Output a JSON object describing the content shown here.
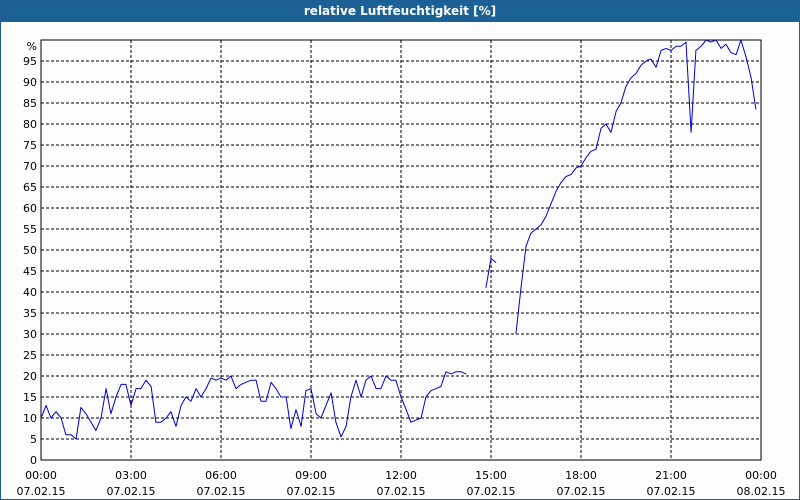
{
  "window": {
    "title": "relative Luftfeuchtigkeit [%]"
  },
  "chart_data": {
    "type": "line",
    "title": "relative Luftfeuchtigkeit [%]",
    "ylabel": "%",
    "ylim": [
      0,
      100
    ],
    "y_ticks": [
      "0",
      "5",
      "10",
      "15",
      "20",
      "25",
      "30",
      "35",
      "40",
      "45",
      "50",
      "55",
      "60",
      "65",
      "70",
      "75",
      "80",
      "85",
      "90",
      "95"
    ],
    "x_ticks": [
      {
        "time": "00:00",
        "date": "07.02.15"
      },
      {
        "time": "03:00",
        "date": "07.02.15"
      },
      {
        "time": "06:00",
        "date": "07.02.15"
      },
      {
        "time": "09:00",
        "date": "07.02.15"
      },
      {
        "time": "12:00",
        "date": "07.02.15"
      },
      {
        "time": "15:00",
        "date": "07.02.15"
      },
      {
        "time": "18:00",
        "date": "07.02.15"
      },
      {
        "time": "21:00",
        "date": "07.02.15"
      },
      {
        "time": "00:00",
        "date": "08.02.15"
      }
    ],
    "xlim_hours": [
      0,
      24
    ],
    "grid": true,
    "line_color": "#0000cc",
    "segments": [
      [
        [
          0.0,
          10
        ],
        [
          0.17,
          13
        ],
        [
          0.33,
          10
        ],
        [
          0.5,
          11.5
        ],
        [
          0.67,
          10
        ],
        [
          0.83,
          6
        ],
        [
          1.0,
          6
        ],
        [
          1.17,
          5
        ],
        [
          1.33,
          12.5
        ],
        [
          1.5,
          11
        ],
        [
          1.67,
          9
        ],
        [
          1.83,
          7
        ],
        [
          2.0,
          10
        ],
        [
          2.17,
          17
        ],
        [
          2.33,
          11
        ],
        [
          2.5,
          15
        ],
        [
          2.67,
          18
        ],
        [
          2.83,
          18
        ],
        [
          3.0,
          13
        ],
        [
          3.17,
          17
        ],
        [
          3.33,
          17
        ],
        [
          3.5,
          19
        ],
        [
          3.67,
          17.5
        ],
        [
          3.83,
          9
        ],
        [
          4.0,
          9
        ],
        [
          4.17,
          10
        ],
        [
          4.33,
          11.5
        ],
        [
          4.5,
          8
        ],
        [
          4.67,
          13
        ],
        [
          4.83,
          15
        ],
        [
          5.0,
          14
        ],
        [
          5.17,
          17
        ],
        [
          5.33,
          15
        ],
        [
          5.5,
          17
        ],
        [
          5.67,
          19.5
        ],
        [
          5.83,
          19
        ],
        [
          6.0,
          19.5
        ],
        [
          6.17,
          19
        ],
        [
          6.33,
          20
        ],
        [
          6.5,
          17
        ],
        [
          6.67,
          18
        ],
        [
          6.83,
          18.5
        ],
        [
          7.0,
          19
        ],
        [
          7.17,
          19
        ],
        [
          7.33,
          14
        ],
        [
          7.5,
          14
        ],
        [
          7.67,
          18.5
        ],
        [
          7.83,
          17
        ],
        [
          8.0,
          15
        ],
        [
          8.17,
          15
        ],
        [
          8.33,
          7.5
        ],
        [
          8.5,
          12
        ],
        [
          8.67,
          8
        ],
        [
          8.83,
          16.5
        ],
        [
          9.0,
          17
        ],
        [
          9.17,
          11
        ],
        [
          9.33,
          10
        ],
        [
          9.5,
          13
        ],
        [
          9.67,
          16
        ],
        [
          9.83,
          9
        ],
        [
          10.0,
          5.5
        ],
        [
          10.17,
          8
        ],
        [
          10.33,
          15
        ],
        [
          10.5,
          19
        ],
        [
          10.67,
          15
        ],
        [
          10.83,
          19
        ],
        [
          11.0,
          20
        ],
        [
          11.17,
          17
        ],
        [
          11.33,
          17
        ],
        [
          11.5,
          20
        ],
        [
          11.67,
          19
        ],
        [
          11.83,
          19
        ],
        [
          12.0,
          15
        ],
        [
          12.17,
          12
        ],
        [
          12.33,
          9
        ],
        [
          12.5,
          9.5
        ],
        [
          12.67,
          10
        ],
        [
          12.83,
          15
        ],
        [
          13.0,
          16.5
        ],
        [
          13.17,
          17
        ],
        [
          13.33,
          17.5
        ],
        [
          13.5,
          21
        ],
        [
          13.67,
          20.5
        ],
        [
          13.83,
          21
        ],
        [
          14.0,
          21
        ],
        [
          14.17,
          20.5
        ]
      ],
      [
        [
          14.83,
          41
        ],
        [
          15.0,
          48
        ],
        [
          15.17,
          47
        ]
      ],
      [
        [
          15.83,
          30
        ],
        [
          16.0,
          41
        ],
        [
          16.17,
          51
        ],
        [
          16.33,
          54
        ],
        [
          16.5,
          55
        ],
        [
          16.67,
          56
        ],
        [
          16.83,
          58
        ],
        [
          17.0,
          61
        ],
        [
          17.17,
          64
        ],
        [
          17.33,
          66
        ],
        [
          17.5,
          67.5
        ],
        [
          17.67,
          68
        ],
        [
          17.83,
          69.5
        ],
        [
          18.0,
          70
        ],
        [
          18.17,
          72
        ],
        [
          18.33,
          73.5
        ],
        [
          18.5,
          74
        ],
        [
          18.67,
          79
        ],
        [
          18.83,
          80
        ],
        [
          19.0,
          78
        ],
        [
          19.17,
          83
        ],
        [
          19.33,
          85
        ],
        [
          19.5,
          89
        ],
        [
          19.67,
          91
        ],
        [
          19.83,
          92
        ],
        [
          20.0,
          94
        ],
        [
          20.17,
          95
        ],
        [
          20.33,
          95.5
        ],
        [
          20.5,
          93.5
        ],
        [
          20.67,
          97.5
        ],
        [
          20.83,
          98
        ],
        [
          21.0,
          97.5
        ],
        [
          21.17,
          98.5
        ],
        [
          21.33,
          98.5
        ],
        [
          21.5,
          99.5
        ],
        [
          21.67,
          78
        ],
        [
          21.83,
          97.5
        ],
        [
          22.0,
          98.5
        ],
        [
          22.17,
          100
        ],
        [
          22.33,
          99.5
        ],
        [
          22.5,
          100
        ],
        [
          22.67,
          98
        ],
        [
          22.83,
          99
        ],
        [
          23.0,
          97
        ],
        [
          23.17,
          96.5
        ],
        [
          23.33,
          100
        ],
        [
          23.5,
          96
        ],
        [
          23.67,
          91
        ],
        [
          23.83,
          83.5
        ]
      ]
    ]
  }
}
